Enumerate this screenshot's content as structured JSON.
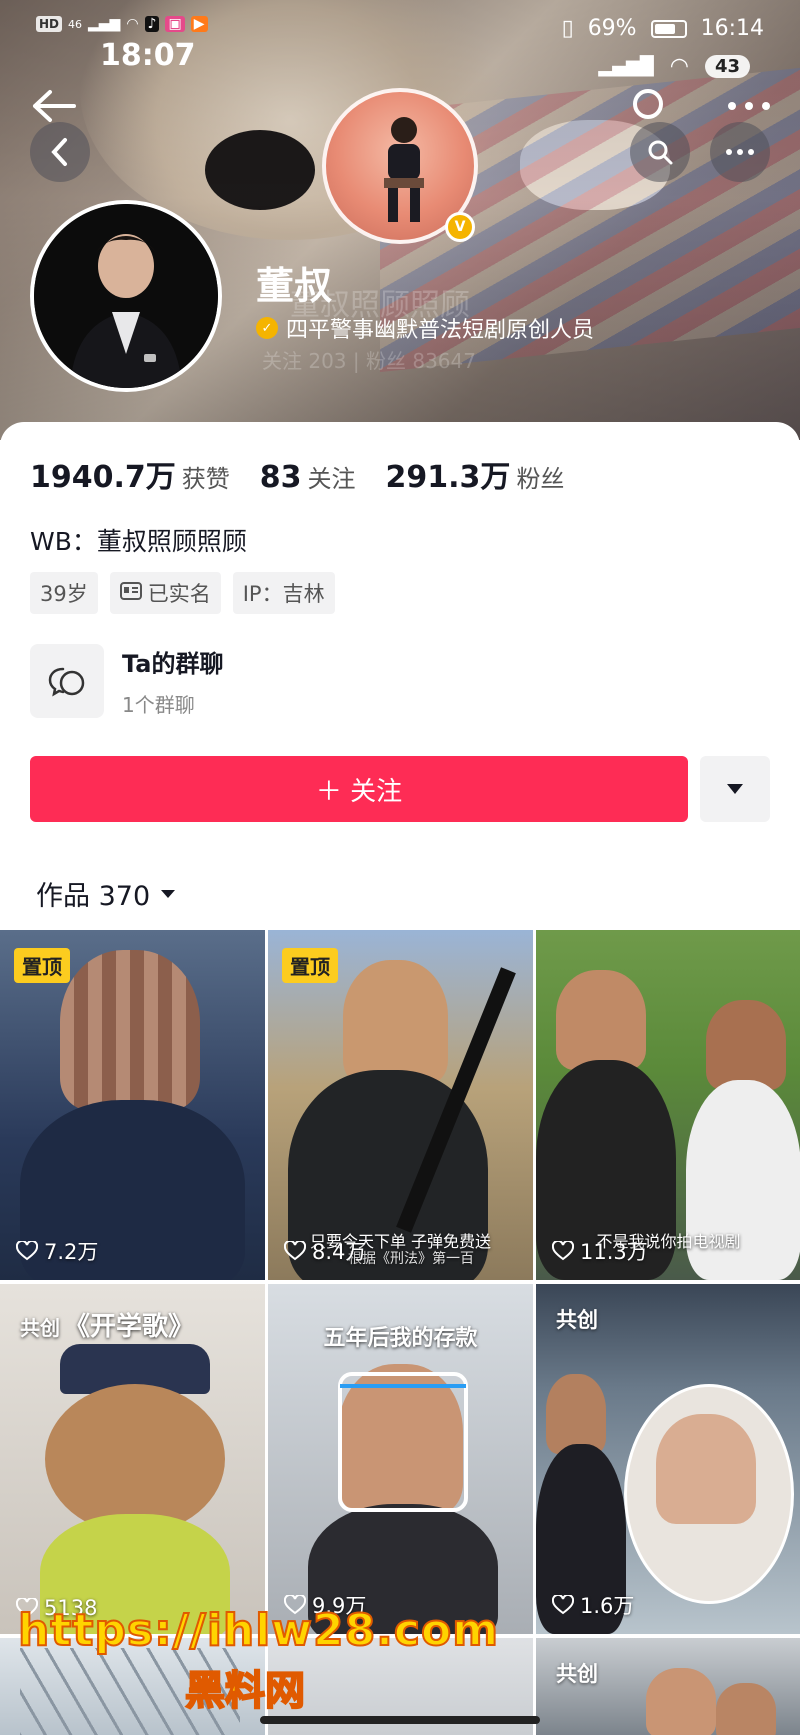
{
  "status_bar": {
    "left_badges": [
      "HD",
      "46"
    ],
    "time_back": "18:07",
    "battery_pct": "69%",
    "time": "16:14",
    "notif_count": "43"
  },
  "profile": {
    "name": "董叔",
    "description": "四平警事幽默普法短剧原创人员",
    "ghost_name": "董叔照顾照顾",
    "ghost_stats": "关注  203   |   粉丝  83647"
  },
  "stats": [
    {
      "value": "1940.7万",
      "label": "获赞"
    },
    {
      "value": "83",
      "label": "关注"
    },
    {
      "value": "291.3万",
      "label": "粉丝"
    }
  ],
  "weibo": "WB：董叔照顾照顾",
  "tags": [
    "39岁",
    "已实名",
    "IP：吉林"
  ],
  "group": {
    "title": "Ta的群聊",
    "subtitle": "1个群聊"
  },
  "follow_button": "＋ 关注",
  "works_tab": "作品 370",
  "videos": [
    {
      "badge": "置顶",
      "likes": "7.2万"
    },
    {
      "badge": "置顶",
      "likes": "8.4万",
      "subtitle": "只要今天下单 子弹免费送",
      "subtitle2": "根据《刑法》第一百"
    },
    {
      "badge": "",
      "likes": "11.3万",
      "subtitle": "不是我说你拍电视剧"
    },
    {
      "badge": "共创",
      "likes": "5138",
      "caption": "《开学歌》"
    },
    {
      "badge": "",
      "likes": "9.9万",
      "caption": "五年后我的存款"
    },
    {
      "badge": "共创",
      "likes": "1.6万"
    },
    {
      "badge": "",
      "likes": ""
    },
    {
      "badge": "",
      "likes": ""
    },
    {
      "badge": "共创",
      "likes": ""
    }
  ],
  "watermark": {
    "line1": "https://ihlw28.com",
    "line2": "黑料网"
  },
  "colors": {
    "accent": "#fe2c55",
    "pin_badge": "#fccc1f",
    "verified": "#f5b400"
  }
}
